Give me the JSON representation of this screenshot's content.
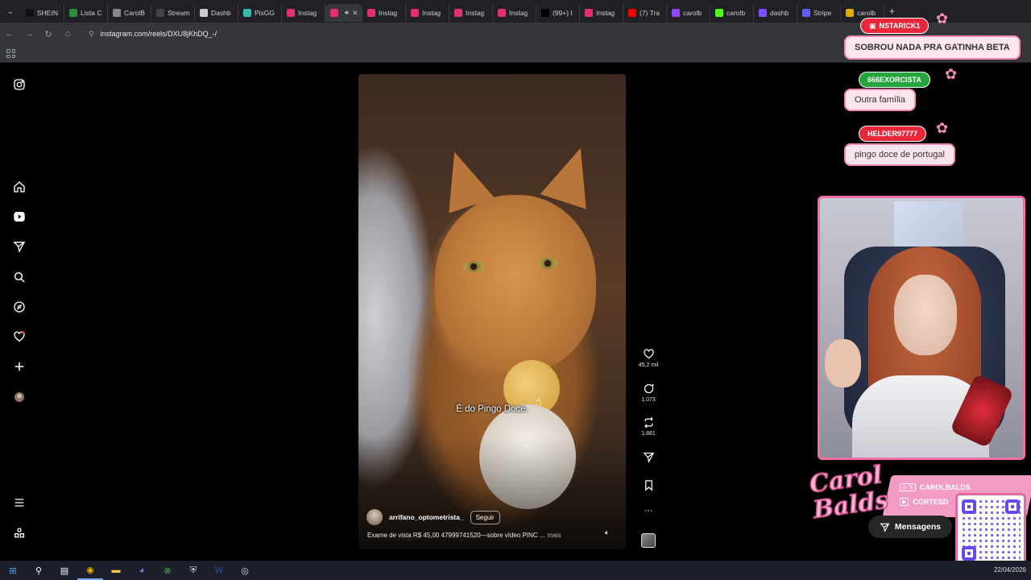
{
  "browser": {
    "tabs": [
      {
        "label": "SHEIN",
        "color": "#111111"
      },
      {
        "label": "Lista C",
        "color": "#2e8b3d"
      },
      {
        "label": "CarolB",
        "color": "#888888"
      },
      {
        "label": "Stream",
        "color": "#444444"
      },
      {
        "label": "Dashb",
        "color": "#cccccc"
      },
      {
        "label": "PixGG",
        "color": "#32bcad"
      },
      {
        "label": "Instag",
        "color": "#e1306c"
      },
      {
        "label": "",
        "color": "#e1306c",
        "active": true
      },
      {
        "label": "Instag",
        "color": "#e1306c"
      },
      {
        "label": "Instag",
        "color": "#e1306c"
      },
      {
        "label": "Instag",
        "color": "#e1306c"
      },
      {
        "label": "Instag",
        "color": "#e1306c"
      },
      {
        "label": "(99+) I",
        "color": "#000000"
      },
      {
        "label": "Instag",
        "color": "#e1306c"
      },
      {
        "label": "(7) Tra",
        "color": "#ff0000"
      },
      {
        "label": "carolb",
        "color": "#9146ff"
      },
      {
        "label": "carolb",
        "color": "#53fc18"
      },
      {
        "label": "dashb",
        "color": "#7a4cff"
      },
      {
        "label": "Stripe",
        "color": "#635bff"
      },
      {
        "label": "carolb",
        "color": "#e0a800"
      }
    ],
    "url": "instagram.com/reels/DXU8jKhDQ_-/"
  },
  "reel": {
    "subtitle": "É do Pingo Doce.",
    "author": "arrifano_optometrista_",
    "follow_label": "Seguir",
    "caption": "Exame de vista R$ 45,00 47999741520—sobre vídeo PINC ...",
    "more_label": "mais"
  },
  "actions": {
    "likes": "45,2 mil",
    "comments": "1.073",
    "reposts": "1.881"
  },
  "chat": [
    {
      "user": "NSTARICK1",
      "message": "SOBROU NADA PRA GATINHA BETA",
      "color": "#e8273a"
    },
    {
      "user": "666EXORCISTA",
      "message": "Outra família",
      "color": "#25a63c"
    },
    {
      "user": "HELDER97777",
      "message": "pingo doce de portugal",
      "color": "#e8273a"
    }
  ],
  "overlay": {
    "brand_sign": "Carol Balds",
    "social_1": "CAROLBALDS",
    "social_2": "CORTESD",
    "messages_label": "Mensagens"
  },
  "taskbar": {
    "date": "22/04/2026"
  }
}
